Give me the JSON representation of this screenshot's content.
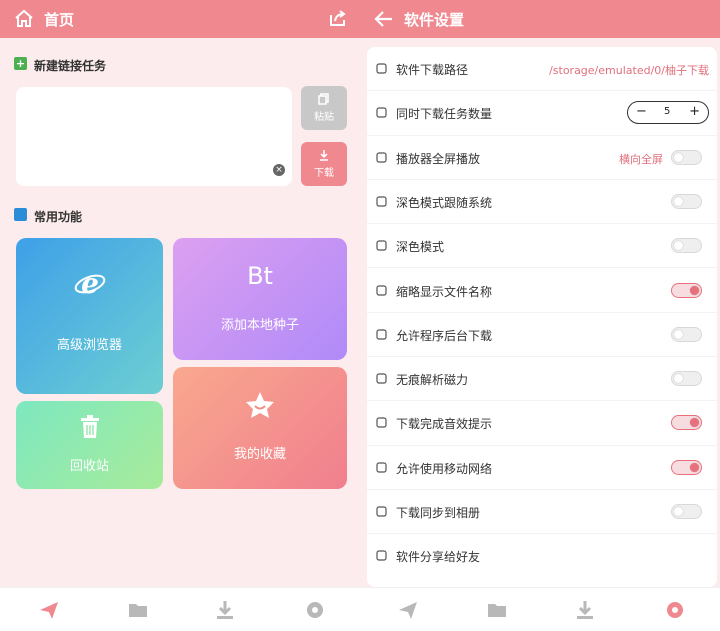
{
  "left": {
    "title": "首页",
    "new_task_title": "新建链接任务",
    "paste_label": "粘贴",
    "download_label": "下载",
    "common_title": "常用功能",
    "cards": {
      "browser": "高级浏览器",
      "bt_badge": "Bt",
      "bt": "添加本地种子",
      "recycle": "回收站",
      "favorites": "我的收藏"
    }
  },
  "right": {
    "title": "软件设置",
    "rows": [
      {
        "label": "软件下载路径",
        "value": "/storage/emulated/0/柚子下载",
        "icon": "folder-download-icon"
      },
      {
        "label": "同时下载任务数量",
        "stepper": {
          "minus": "−",
          "value": "5",
          "plus": "+"
        },
        "icon": "list-icon"
      },
      {
        "label": "播放器全屏播放",
        "value": "横向全屏",
        "toggle": false,
        "icon": "fullscreen-icon"
      },
      {
        "label": "深色模式跟随系统",
        "toggle": false,
        "icon": "moon-icon"
      },
      {
        "label": "深色模式",
        "toggle": false,
        "icon": "moon-icon"
      },
      {
        "label": "缩略显示文件名称",
        "toggle": true,
        "icon": "list-bullets-icon"
      },
      {
        "label": "允许程序后台下载",
        "toggle": false,
        "icon": "background-download-icon"
      },
      {
        "label": "无痕解析磁力",
        "toggle": false,
        "icon": "incognito-icon"
      },
      {
        "label": "下载完成音效提示",
        "toggle": true,
        "icon": "sound-icon"
      },
      {
        "label": "允许使用移动网络",
        "toggle": true,
        "icon": "signal-icon"
      },
      {
        "label": "下载同步到相册",
        "toggle": false,
        "icon": "sync-icon"
      },
      {
        "label": "软件分享给好友",
        "icon": "share-icon"
      }
    ]
  },
  "colors": {
    "accent": "#f08890",
    "bg": "#fdeced",
    "toggle_on": "#e8707c"
  }
}
